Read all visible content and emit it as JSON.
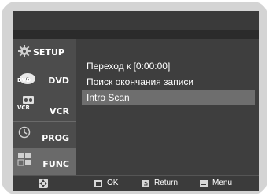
{
  "sidebar": {
    "items": [
      {
        "label": "SETUP",
        "icon": "gear-icon"
      },
      {
        "label": "DVD",
        "icon": "dvd-icon",
        "icon_text": "DVD"
      },
      {
        "label": "VCR",
        "icon": "vcr-icon",
        "icon_text": "VCR"
      },
      {
        "label": "PROG",
        "icon": "clock-icon"
      },
      {
        "label": "FUNC",
        "icon": "function-grid-icon"
      }
    ],
    "active_index": 4
  },
  "menu": {
    "items": [
      {
        "label": "Переход к [0:00:00]"
      },
      {
        "label": "Поиск окончания записи"
      },
      {
        "label": "Intro Scan"
      }
    ],
    "selected_index": 2
  },
  "bottom": {
    "nav_icon": "direction-pad-icon",
    "ok_label": "OK",
    "return_label": "Return",
    "menu_label": "Menu"
  },
  "colors": {
    "frame": "#d4d4d4",
    "screen_bg": "#323232",
    "highlight": "#6e6e6e",
    "text": "#ffffff"
  }
}
